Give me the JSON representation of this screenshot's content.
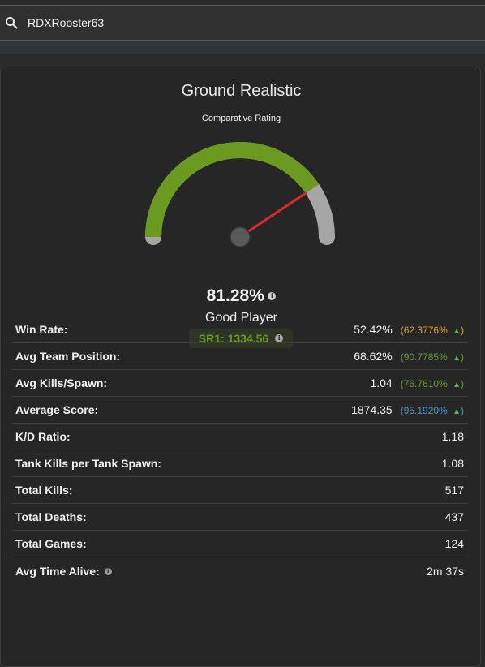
{
  "search": {
    "value": "RDXRooster63"
  },
  "card": {
    "title": "Ground Realistic",
    "subtitle": "Comparative Rating",
    "gauge": {
      "value_percent": 81.28,
      "colors": {
        "fill": "#6a9a1f",
        "rest": "#a6a6a6",
        "needle": "#e0262d",
        "hub": "#5a5a5a"
      }
    },
    "rating_percent": "81.28%",
    "rating_label": "Good Player",
    "sr_text": "SR1: 1334.56"
  },
  "stats": [
    {
      "label": "Win Rate:",
      "value": "52.42%",
      "pct": "(62.3776%",
      "pct_color": "yellow"
    },
    {
      "label": "Avg Team Position:",
      "value": "68.62%",
      "pct": "(90.7785%",
      "pct_color": "green"
    },
    {
      "label": "Avg Kills/Spawn:",
      "value": "1.04",
      "pct": "(76.7610%",
      "pct_color": "green"
    },
    {
      "label": "Average Score:",
      "value": "1874.35",
      "pct": "(95.1920%",
      "pct_color": "blue"
    },
    {
      "label": "K/D Ratio:",
      "value": "1.18"
    },
    {
      "label": "Tank Kills per Tank Spawn:",
      "value": "1.08"
    },
    {
      "label": "Total Kills:",
      "value": "517"
    },
    {
      "label": "Total Deaths:",
      "value": "437"
    },
    {
      "label": "Total Games:",
      "value": "124"
    },
    {
      "label": "Avg Time Alive:",
      "value": "2m 37s",
      "info": true
    }
  ],
  "arrow_glyph": "▲)"
}
